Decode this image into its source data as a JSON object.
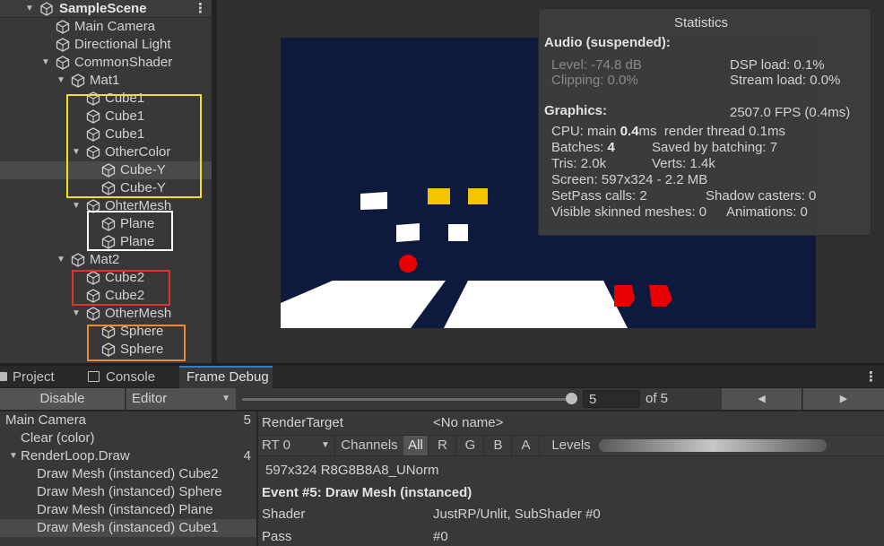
{
  "hierarchy": {
    "scene_name": "SampleScene",
    "items": [
      {
        "label": "Main Camera"
      },
      {
        "label": "Directional Light"
      },
      {
        "label": "CommonShader"
      },
      {
        "label": "Mat1"
      },
      {
        "label": "Cube1"
      },
      {
        "label": "Cube1"
      },
      {
        "label": "Cube1"
      },
      {
        "label": "OtherColor"
      },
      {
        "label": "Cube-Y"
      },
      {
        "label": "Cube-Y"
      },
      {
        "label": "OhterMesh"
      },
      {
        "label": "Plane"
      },
      {
        "label": "Plane"
      },
      {
        "label": "Mat2"
      },
      {
        "label": "Cube2"
      },
      {
        "label": "Cube2"
      },
      {
        "label": "OtherMesh"
      },
      {
        "label": "Sphere"
      },
      {
        "label": "Sphere"
      }
    ],
    "highlight_colors": {
      "yellow": "#f0e020",
      "white": "#ffffff",
      "red": "#e03030",
      "orange": "#f08a30"
    }
  },
  "game_view": {
    "background": "#0d1a3d",
    "object_colors": {
      "white": "#ffffff",
      "yellow": "#f5c400",
      "red": "#e80000"
    }
  },
  "statistics": {
    "title": "Statistics",
    "audio_heading": "Audio (suspended):",
    "level": "Level: -74.8 dB",
    "clipping": "Clipping: 0.0%",
    "dsp_load": "DSP load: 0.1%",
    "stream_load": "Stream load: 0.0%",
    "graphics_heading": "Graphics:",
    "fps": "2507.0 FPS (0.4ms)",
    "cpu_prefix": "CPU: main ",
    "cpu_main": "0.4",
    "cpu_suffix": "ms  render thread 0.1ms",
    "batches_prefix": "Batches: ",
    "batches_value": "4",
    "saved_by_batching": "Saved by batching: 7",
    "tris": "Tris: 2.0k",
    "verts": "Verts: 1.4k",
    "screen": "Screen: 597x324 - 2.2 MB",
    "setpass": "SetPass calls: 2",
    "shadow_casters": "Shadow casters: 0",
    "skinned": "Visible skinned meshes: 0",
    "animations": "Animations: 0"
  },
  "tabs": [
    {
      "label": "Project"
    },
    {
      "label": "Console"
    },
    {
      "label": "Frame Debug"
    }
  ],
  "toolbar": {
    "disable_label": "Disable",
    "editor_label": "Editor",
    "step_value": "5",
    "of_label": "of 5",
    "slider_progress": 1.0,
    "prev_icon": "◀",
    "next_icon": "▶"
  },
  "events": [
    {
      "label": "Main Camera",
      "count": "5"
    },
    {
      "label": "Clear (color)",
      "count": ""
    },
    {
      "label": "RenderLoop.Draw",
      "count": "4"
    },
    {
      "label": "Draw Mesh (instanced) Cube2",
      "count": ""
    },
    {
      "label": "Draw Mesh (instanced) Sphere",
      "count": ""
    },
    {
      "label": "Draw Mesh (instanced) Plane",
      "count": ""
    },
    {
      "label": "Draw Mesh (instanced) Cube1",
      "count": ""
    }
  ],
  "details": {
    "render_target_label": "RenderTarget",
    "render_target_value": "<No name>",
    "rt_label": "RT 0",
    "channels_label": "Channels",
    "channel_all": "All",
    "channel_r": "R",
    "channel_g": "G",
    "channel_b": "B",
    "channel_a": "A",
    "levels_label": "Levels",
    "format": "597x324 R8G8B8A8_UNorm",
    "event_title": "Event #5: Draw Mesh (instanced)",
    "shader_label": "Shader",
    "shader_value": "JustRP/Unlit, SubShader #0",
    "pass_label": "Pass",
    "pass_value": "#0"
  }
}
